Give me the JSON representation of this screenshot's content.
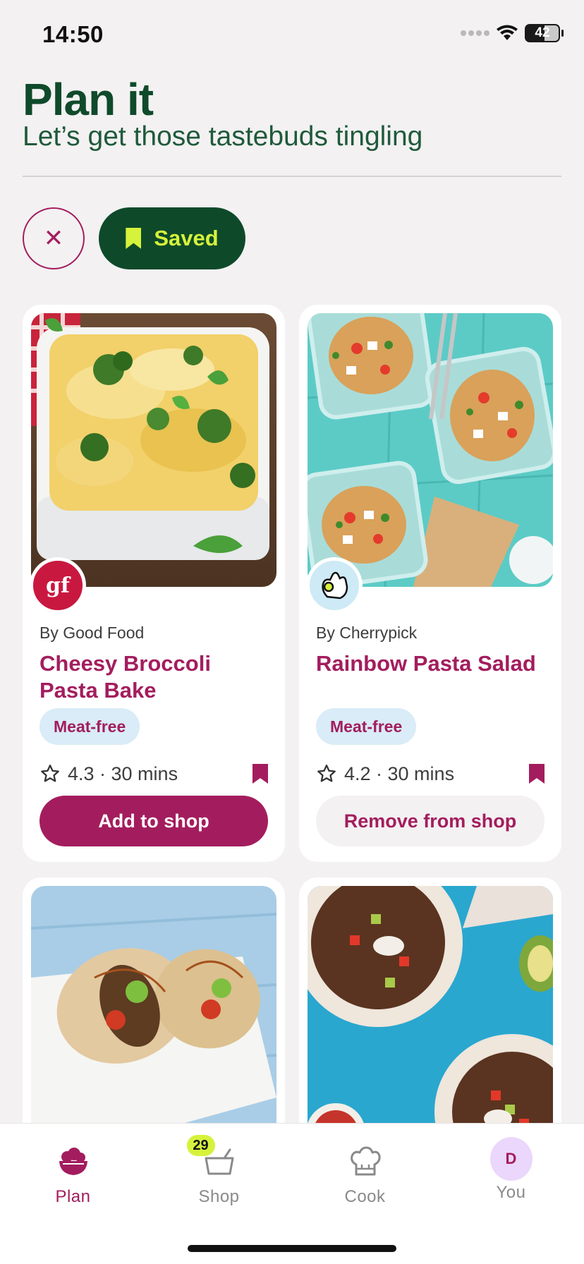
{
  "status_bar": {
    "time": "14:50",
    "battery": "42"
  },
  "header": {
    "title": "Plan it",
    "subtitle": "Let’s get those tastebuds tingling"
  },
  "filters": {
    "saved_label": "Saved"
  },
  "recipes": [
    {
      "source": "By Good Food",
      "title": "Cheesy Broccoli Pasta Bake",
      "tag": "Meat-free",
      "meta": "4.3 · 30 mins",
      "action": "Add to shop",
      "logo_text": "gf"
    },
    {
      "source": "By Cherrypick",
      "title": "Rainbow Pasta Salad",
      "tag": "Meat-free",
      "meta": "4.2 · 30 mins",
      "action": "Remove from shop"
    }
  ],
  "tabs": [
    {
      "label": "Plan",
      "icon": "plan-bowl-icon",
      "active": true
    },
    {
      "label": "Shop",
      "icon": "basket-icon",
      "badge": "29"
    },
    {
      "label": "Cook",
      "icon": "chef-hat-icon"
    },
    {
      "label": "You",
      "avatar": "D"
    }
  ],
  "colors": {
    "brand_green": "#0e4a2a",
    "accent_magenta": "#a31d5e",
    "chip_lime": "#d6f23b",
    "tag_blue": "#d9ecf7"
  }
}
